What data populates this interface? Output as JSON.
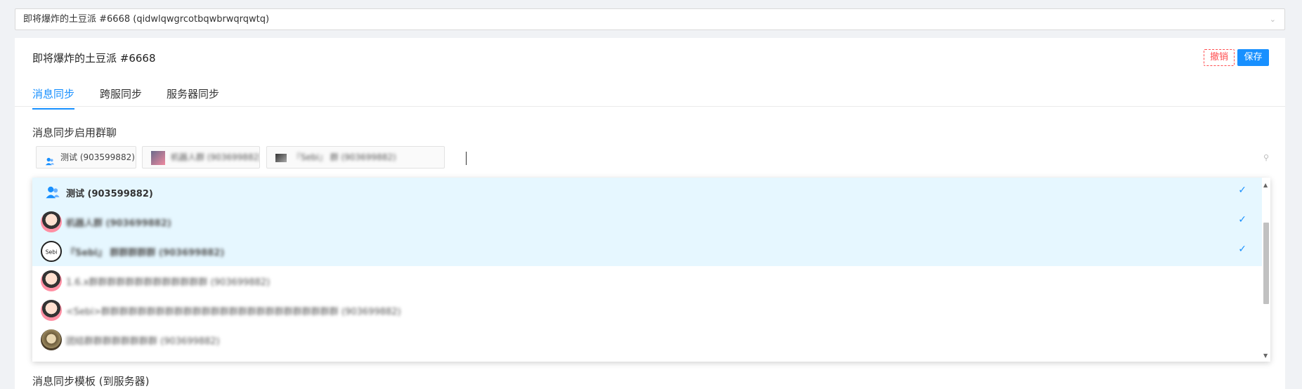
{
  "bot_select": {
    "value": "即将爆炸的土豆派 #6668 (qidwlqwgrcotbqwbrwqrqwtq)"
  },
  "card": {
    "title": "即将爆炸的土豆派 #6668",
    "cancel_label": "撤销",
    "save_label": "保存"
  },
  "tabs": [
    {
      "label": "消息同步",
      "active": true
    },
    {
      "label": "跨服同步",
      "active": false
    },
    {
      "label": "服务器同步",
      "active": false
    }
  ],
  "message_sync": {
    "section_label": "消息同步启用群聊",
    "tags": [
      {
        "label": "测试 (903599882)",
        "icon": "group-icon"
      },
      {
        "label": "机器人群 (903699882)",
        "icon": "avatar-image"
      },
      {
        "label": "『Sebi』 群 (903699882)",
        "icon": "avatar-image"
      }
    ]
  },
  "dropdown": {
    "options": [
      {
        "label": "测试 (903599882)",
        "selected": true,
        "icon": "group-icon"
      },
      {
        "label": "机器人群 (903699882)",
        "selected": true,
        "icon": "avatar-image"
      },
      {
        "label": "『Sebi』 群群群群群 (903699882)",
        "selected": true,
        "icon": "logo-image"
      },
      {
        "label": "1.6.x群群群群群群群群群群群群群 (903699882)",
        "selected": false,
        "icon": "avatar-image"
      },
      {
        "label": "<Sebi>群群群群群群群群群群群群群群群群群群群群群群群群群群 (903699882)",
        "selected": false,
        "icon": "avatar-image"
      },
      {
        "label": "团结群群群群群群群群 (903699882)",
        "selected": false,
        "icon": "avatar-image"
      }
    ]
  },
  "bottom_label": "消息同步模板 (到服务器)",
  "colors": {
    "accent": "#1890ff",
    "danger": "#ff4d4f",
    "selected_bg": "#e6f7ff"
  }
}
